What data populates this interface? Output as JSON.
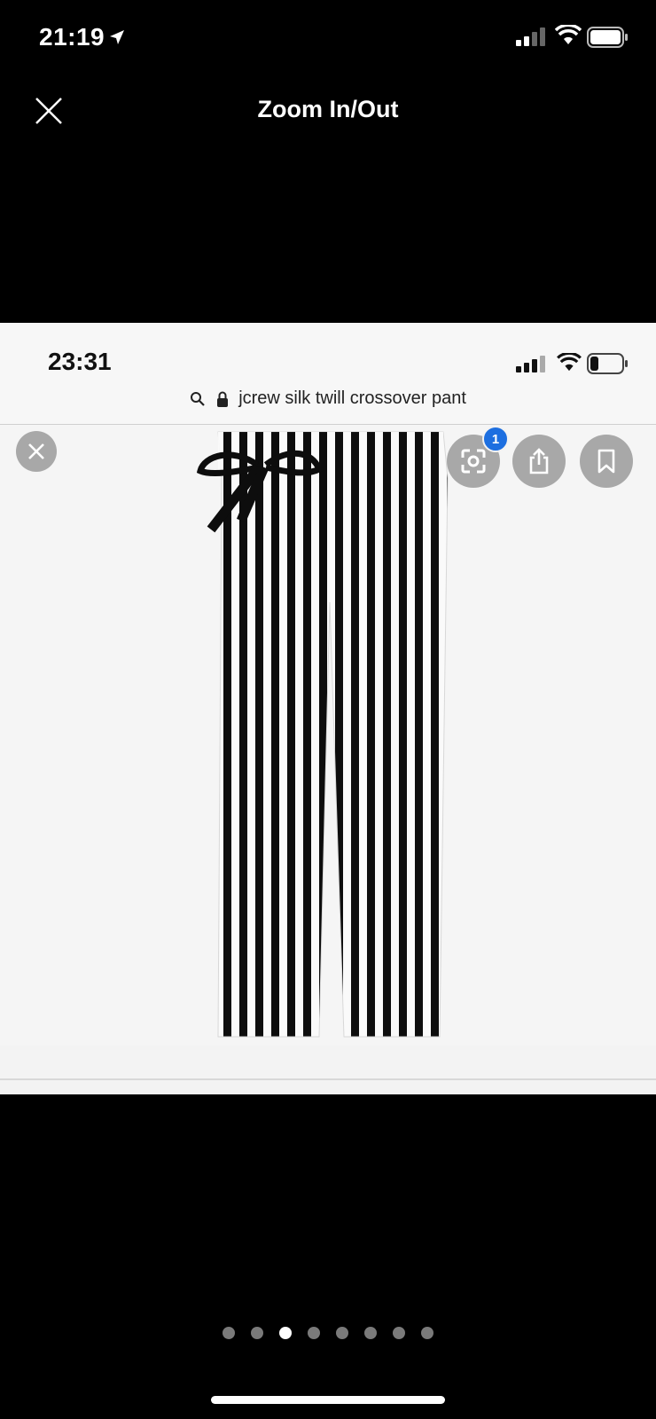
{
  "outer_status": {
    "time": "21:19"
  },
  "header": {
    "title": "Zoom In/Out"
  },
  "inner_screenshot": {
    "status_time": "23:31",
    "url": "jcrew silk twill crossover pant",
    "lens_badge_count": "1"
  },
  "pager": {
    "total": 8,
    "active_index": 2
  },
  "colors": {
    "background": "#000000",
    "badge": "#1d6fe0",
    "button_gray": "#a8a8a8"
  }
}
